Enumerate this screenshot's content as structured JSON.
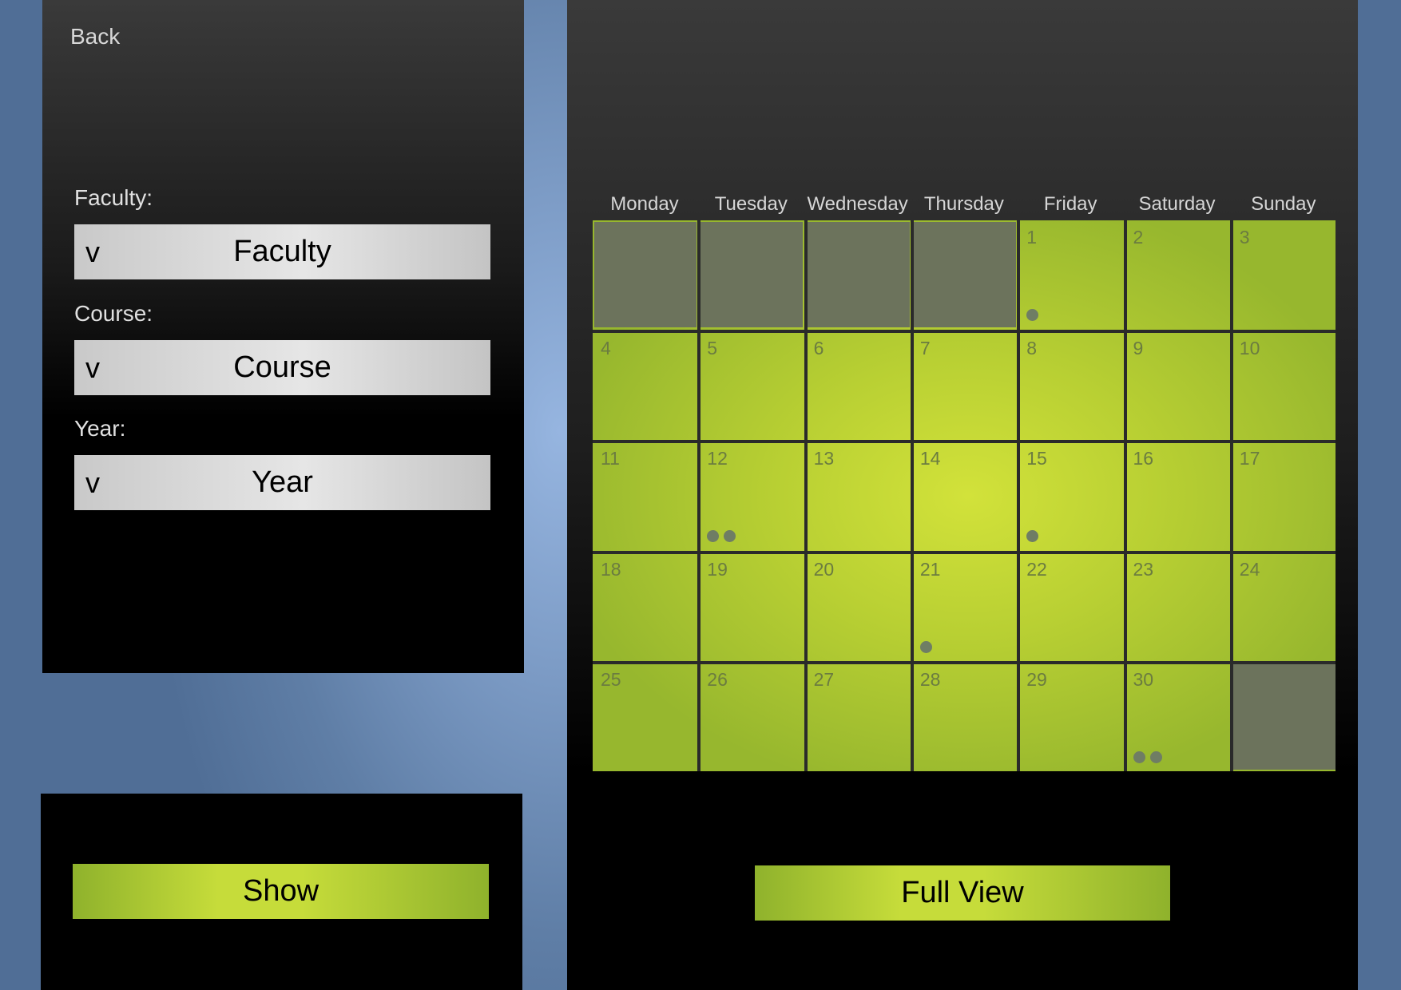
{
  "filter": {
    "back_label": "Back",
    "faculty_label": "Faculty:",
    "faculty_value": "Faculty",
    "course_label": "Course:",
    "course_value": "Course",
    "year_label": "Year:",
    "year_value": "Year",
    "chevron": "v",
    "show_label": "Show"
  },
  "calendar": {
    "weekdays": [
      "Monday",
      "Tuesday",
      "Wednesday",
      "Thursday",
      "Friday",
      "Saturday",
      "Sunday"
    ],
    "weeks": [
      [
        {
          "day": ""
        },
        {
          "day": ""
        },
        {
          "day": ""
        },
        {
          "day": ""
        },
        {
          "day": "1",
          "events": 1
        },
        {
          "day": "2"
        },
        {
          "day": "3"
        }
      ],
      [
        {
          "day": "4"
        },
        {
          "day": "5"
        },
        {
          "day": "6"
        },
        {
          "day": "7"
        },
        {
          "day": "8"
        },
        {
          "day": "9"
        },
        {
          "day": "10"
        }
      ],
      [
        {
          "day": "11"
        },
        {
          "day": "12",
          "events": 2
        },
        {
          "day": "13"
        },
        {
          "day": "14"
        },
        {
          "day": "15",
          "events": 1
        },
        {
          "day": "16"
        },
        {
          "day": "17"
        }
      ],
      [
        {
          "day": "18"
        },
        {
          "day": "19"
        },
        {
          "day": "20"
        },
        {
          "day": "21",
          "events": 1
        },
        {
          "day": "22"
        },
        {
          "day": "23"
        },
        {
          "day": "24"
        }
      ],
      [
        {
          "day": "25"
        },
        {
          "day": "26"
        },
        {
          "day": "27"
        },
        {
          "day": "28"
        },
        {
          "day": "29"
        },
        {
          "day": "30",
          "events": 2
        },
        {
          "day": ""
        }
      ]
    ],
    "full_view_label": "Full View"
  },
  "colors": {
    "accent_green": "#c6dc3a",
    "empty_cell": "#6c735c",
    "event_dot": "#6f7d64"
  }
}
